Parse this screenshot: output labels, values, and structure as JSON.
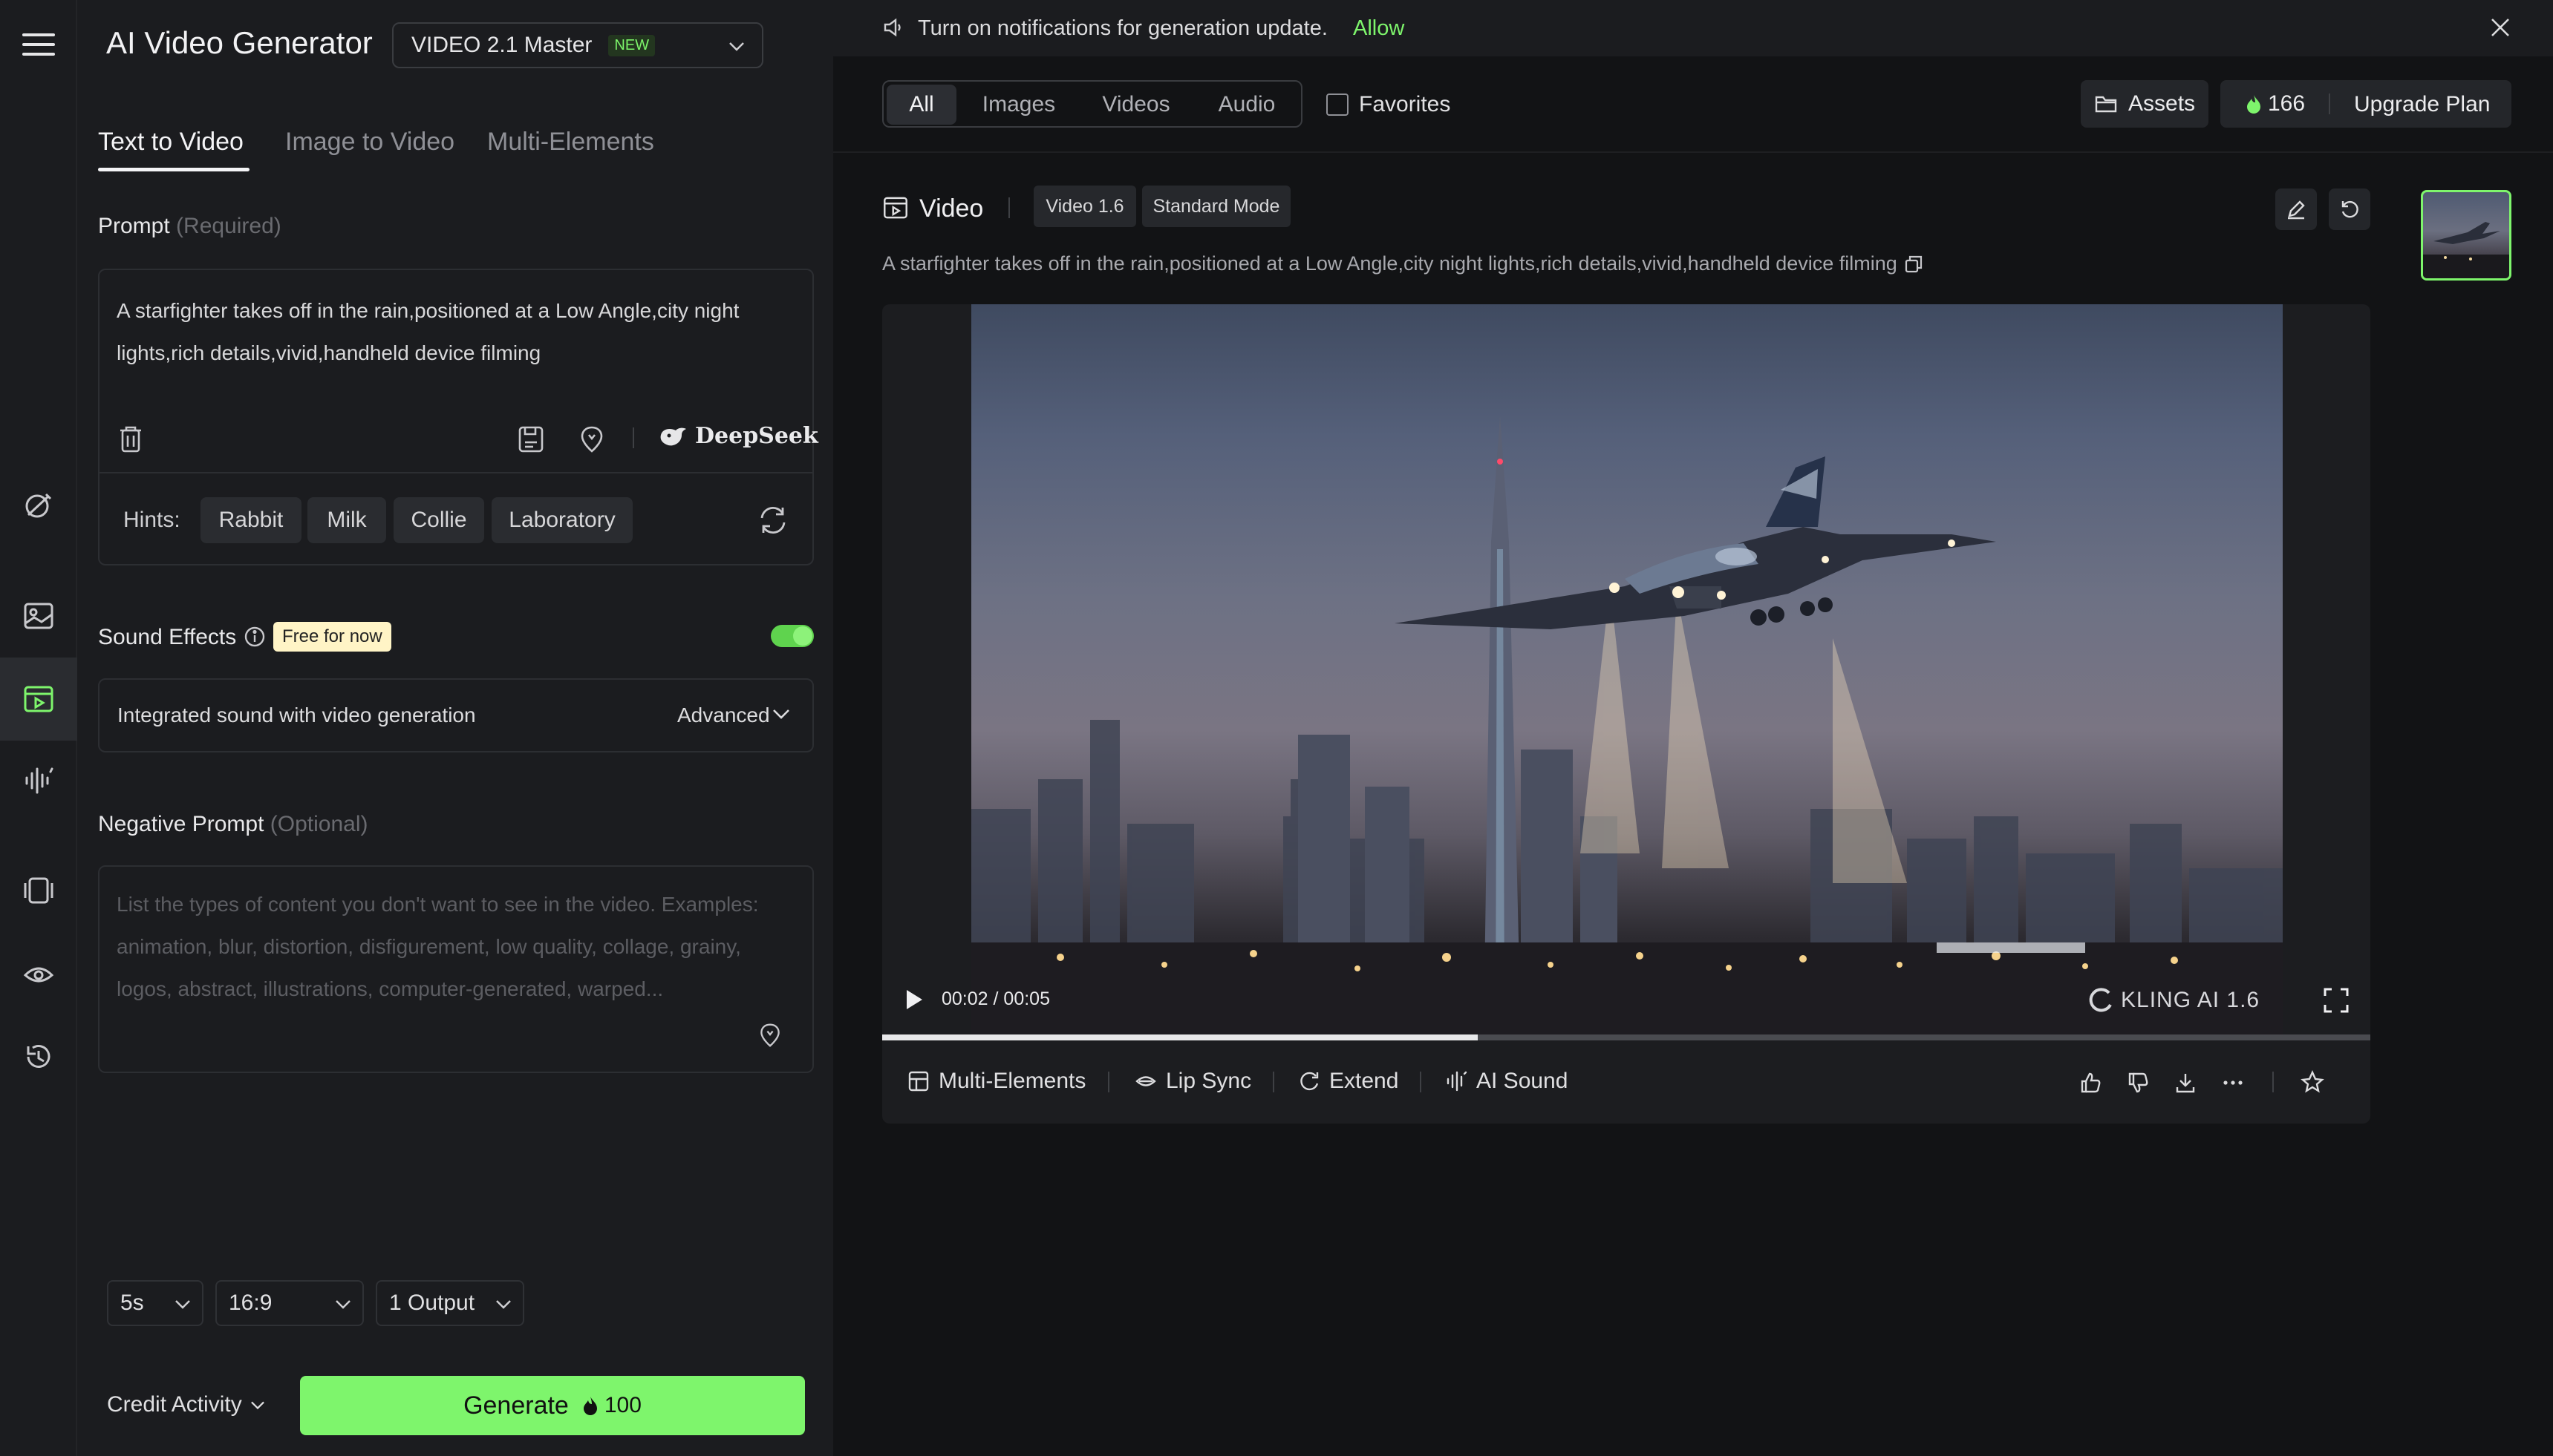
{
  "app": {
    "title": "AI Video Generator"
  },
  "model": {
    "name": "VIDEO 2.1 Master",
    "badge": "NEW"
  },
  "tabs": [
    {
      "label": "Text to Video"
    },
    {
      "label": "Image to Video"
    },
    {
      "label": "Multi-Elements"
    }
  ],
  "prompt": {
    "label": "Prompt",
    "required": "(Required)",
    "text": "A starfighter takes off in the rain,positioned at a Low Angle,city night lights,rich details,vivid,handheld device filming",
    "deepseek": "DeepSeek"
  },
  "hints": {
    "label": "Hints:",
    "items": [
      "Rabbit",
      "Milk",
      "Collie",
      "Laboratory"
    ]
  },
  "sound": {
    "label": "Sound Effects",
    "badge": "Free for now",
    "enabled": true,
    "description": "Integrated sound with video generation",
    "advanced": "Advanced"
  },
  "negative": {
    "label": "Negative Prompt",
    "optional": "(Optional)",
    "placeholder": "List the types of content you don't want to see in the video. Examples: animation, blur, distortion, disfigurement, low quality, collage, grainy, logos, abstract, illustrations, computer-generated, warped..."
  },
  "settings": {
    "duration": "5s",
    "ratio": "16:9",
    "outputs": "1 Output"
  },
  "footer": {
    "credit_activity": "Credit Activity",
    "generate": "Generate",
    "generate_cost": "100"
  },
  "notification": {
    "text": "Turn on notifications for generation update.",
    "allow": "Allow"
  },
  "filters": {
    "items": [
      "All",
      "Images",
      "Videos",
      "Audio"
    ],
    "active": "All",
    "favorites": "Favorites"
  },
  "top_actions": {
    "assets": "Assets",
    "credits": "166",
    "upgrade": "Upgrade Plan"
  },
  "result": {
    "type": "Video",
    "version": "Video 1.6",
    "mode": "Standard Mode",
    "prompt": "A starfighter takes off in the rain,positioned at a Low Angle,city night lights,rich details,vivid,handheld device filming",
    "time_current": "00:02",
    "time_sep": "/",
    "time_total": "00:05",
    "progress": 0.4,
    "watermark": "KLING AI 1.6"
  },
  "video_actions": [
    "Multi-Elements",
    "Lip Sync",
    "Extend",
    "AI Sound"
  ],
  "colors": {
    "accent": "#7ef56c",
    "background": "#121315",
    "panel": "#1b1c1f"
  }
}
